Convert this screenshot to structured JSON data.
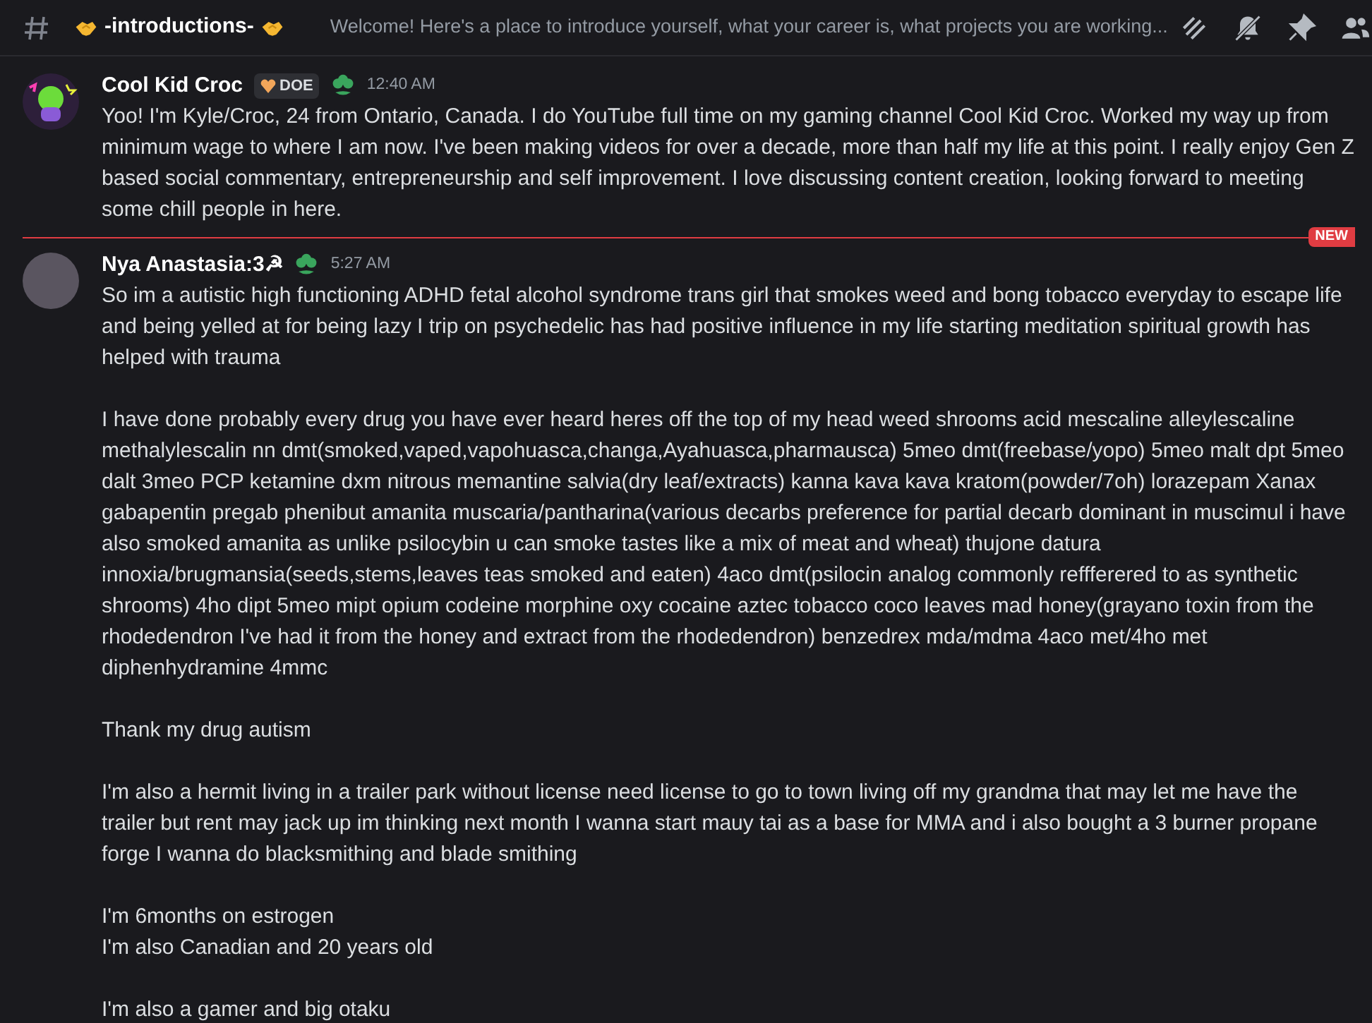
{
  "header": {
    "channel_name": "-introductions-",
    "topic": "Welcome! Here's a place to introduce yourself, what your career is, what projects you are working..."
  },
  "messages": [
    {
      "author": "Cool Kid Croc",
      "tag": "DOE",
      "timestamp": "12:40 AM",
      "paragraphs": [
        "Yoo! I'm Kyle/Croc, 24 from Ontario, Canada. I do YouTube full time on my gaming channel Cool Kid Croc. Worked my way up from minimum wage to where I am now. I've been making videos for over a decade, more than half my life at this point. I really enjoy Gen Z based social commentary, entrepreneurship and self improvement. I love discussing content creation, looking forward to meeting some chill people in here."
      ],
      "new_divider_after": true,
      "divider_label": "NEW"
    },
    {
      "author": "Nya Anastasia:3☭",
      "timestamp": "5:27 AM",
      "paragraphs": [
        "So im a autistic high functioning ADHD fetal alcohol syndrome trans girl that smokes weed and bong tobacco everyday to escape life and being yelled at for being lazy I trip on psychedelic has had positive influence in my life starting meditation spiritual growth has helped with trauma",
        "I have done probably every drug you have ever heard heres off the top of my head weed shrooms acid mescaline alleylescaline methalylescalin nn dmt(smoked,vaped,vapohuasca,changa,Ayahuasca,pharmausca) 5meo dmt(freebase/yopo) 5meo malt dpt 5meo dalt 3meo PCP ketamine dxm nitrous memantine salvia(dry leaf/extracts) kanna kava kava kratom(powder/7oh) lorazepam Xanax gabapentin pregab phenibut amanita muscaria/pantharina(various decarbs preference for partial decarb dominant in muscimul i have also smoked amanita as unlike psilocybin u can smoke tastes like a mix of meat and wheat) thujone datura innoxia/brugmansia(seeds,stems,leaves teas smoked and eaten) 4aco dmt(psilocin analog commonly reffferered to as synthetic shrooms) 4ho dipt 5meo mipt opium codeine morphine oxy cocaine aztec tobacco coco leaves mad honey(grayano toxin from the rhodedendron I've had it from the honey and extract from the rhodedendron) benzedrex mda/mdma 4aco met/4ho met diphenhydramine 4mmc",
        "Thank my drug autism",
        "I'm also a hermit living in a trailer park without license need license to go to town living off my grandma that may let me have the trailer but rent may jack up im thinking next month I wanna start mauy tai as a base for MMA and i also bought a 3 burner propane forge I wanna do blacksmithing and blade smithing",
        "I'm 6months on estrogen\nI'm also Canadian and 20 years old",
        "I'm also a gamer and big otaku"
      ],
      "new_divider_after": false
    }
  ]
}
